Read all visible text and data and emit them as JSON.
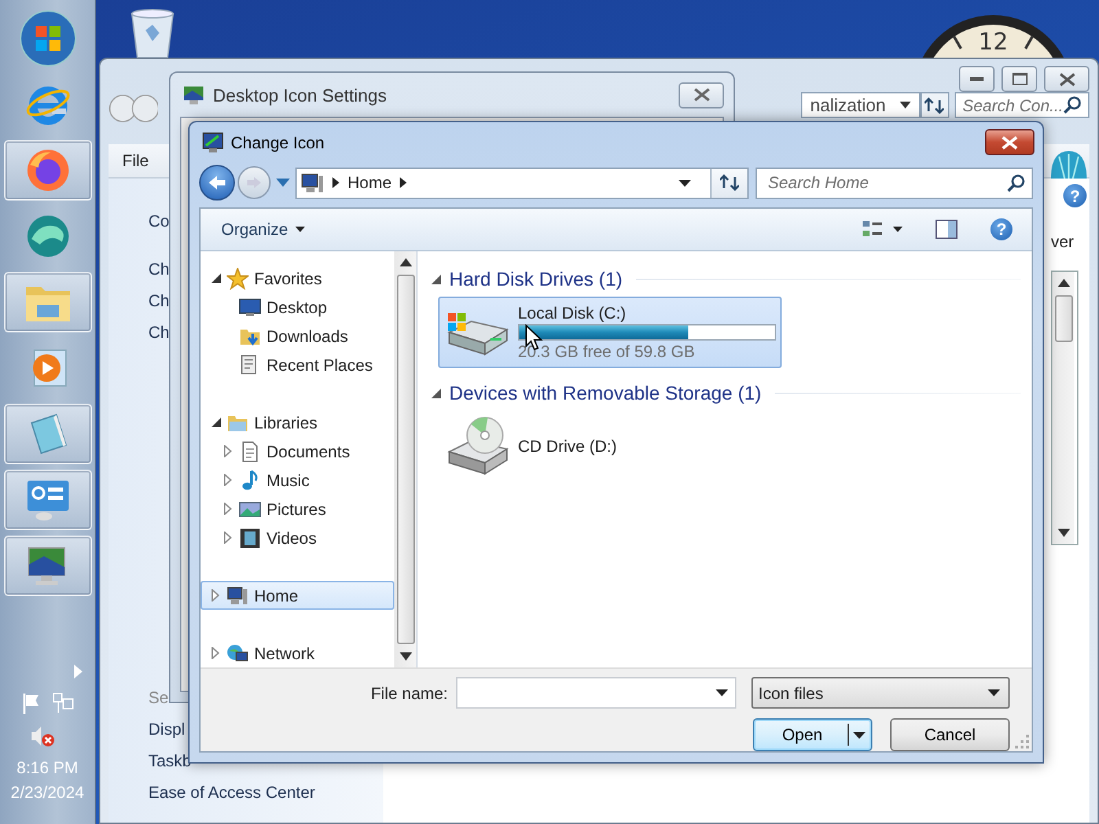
{
  "taskbar": {
    "apps": [
      {
        "kind": "start",
        "running": false
      },
      {
        "kind": "browser-e",
        "running": false
      },
      {
        "kind": "firefox",
        "running": true
      },
      {
        "kind": "edge",
        "running": false
      },
      {
        "kind": "folder",
        "running": true
      },
      {
        "kind": "player",
        "running": false
      },
      {
        "kind": "notepad",
        "running": true
      },
      {
        "kind": "control-panel",
        "running": true
      },
      {
        "kind": "display",
        "running": true
      }
    ],
    "clock": {
      "time": "8:16 PM",
      "date": "2/23/2024"
    }
  },
  "desktop": {
    "clock_gadget": "12"
  },
  "back_window": {
    "address": "nalization",
    "search": {
      "placeholder": "Search Con..."
    },
    "menu": [
      "File"
    ],
    "help": "?",
    "left_top": [
      "Co",
      "Ch",
      "Ch",
      "Ch"
    ],
    "see_also": {
      "title": "Se",
      "links": [
        "Displ",
        "Taskb",
        "Ease of Access Center"
      ]
    },
    "right_text": "ver"
  },
  "desktop_icon_settings": {
    "title": "Desktop Icon Settings"
  },
  "change_icon": {
    "title": "Change Icon",
    "breadcrumb": [
      "Home"
    ],
    "search": {
      "placeholder": "Search Home"
    },
    "organize": "Organize",
    "help": "?",
    "nav": [
      {
        "label": "Favorites",
        "kind": "star",
        "expanded": true,
        "selected": false,
        "children": [
          {
            "label": "Desktop",
            "kind": "desktop",
            "selected": false
          },
          {
            "label": "Downloads",
            "kind": "downloads",
            "selected": false
          },
          {
            "label": "Recent Places",
            "kind": "recent",
            "selected": false
          }
        ]
      },
      {
        "label": "Libraries",
        "kind": "library",
        "expanded": true,
        "selected": false,
        "children": [
          {
            "label": "Documents",
            "kind": "documents",
            "expanded": false,
            "selected": false
          },
          {
            "label": "Music",
            "kind": "music",
            "expanded": false,
            "selected": false
          },
          {
            "label": "Pictures",
            "kind": "pictures",
            "expanded": false,
            "selected": false
          },
          {
            "label": "Videos",
            "kind": "videos",
            "expanded": false,
            "selected": false
          }
        ]
      },
      {
        "label": "Home",
        "kind": "computer",
        "expanded": false,
        "selected": true
      },
      {
        "label": "Network",
        "kind": "network",
        "expanded": false,
        "selected": false
      }
    ],
    "groups": [
      {
        "title": "Hard Disk Drives (1)",
        "expanded": true,
        "items": [
          {
            "kind": "hdd",
            "name": "Local Disk (C:)",
            "level": 0.66,
            "free": "20.3 GB free of 59.8 GB",
            "selected": true
          }
        ]
      },
      {
        "title": "Devices with Removable Storage (1)",
        "expanded": true,
        "items": [
          {
            "kind": "cd",
            "name": "CD Drive (D:)",
            "selected": false
          }
        ]
      }
    ],
    "file_name_label": "File name:",
    "file_type": "Icon files",
    "buttons": [
      {
        "label": "Open",
        "kind": "split",
        "default": true
      },
      {
        "label": "Cancel",
        "kind": "plain",
        "default": false
      }
    ]
  }
}
